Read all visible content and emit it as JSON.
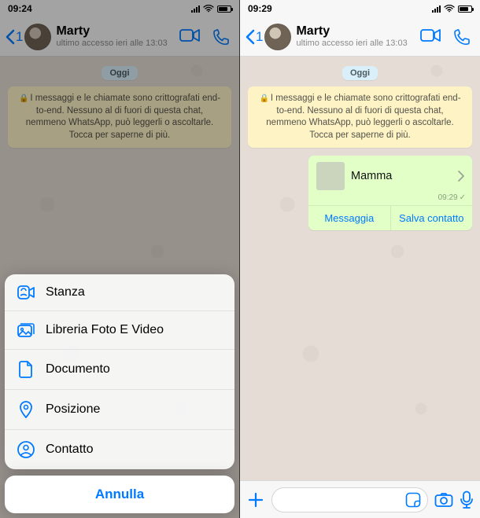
{
  "left": {
    "status_time": "09:24",
    "back_count": "1",
    "contact_name": "Marty",
    "last_seen": "ultimo accesso ieri alle 13:03",
    "day_label": "Oggi",
    "encryption_text": "I messaggi e le chiamate sono crittografati end-to-end. Nessuno al di fuori di questa chat, nemmeno WhatsApp, può leggerli o ascoltarle. Tocca per saperne di più.",
    "sheet": {
      "items": [
        {
          "label": "Stanza"
        },
        {
          "label": "Libreria Foto E Video"
        },
        {
          "label": "Documento"
        },
        {
          "label": "Posizione"
        },
        {
          "label": "Contatto"
        }
      ],
      "cancel": "Annulla"
    }
  },
  "right": {
    "status_time": "09:29",
    "back_count": "1",
    "contact_name": "Marty",
    "last_seen": "ultimo accesso ieri alle 13:03",
    "day_label": "Oggi",
    "encryption_text": "I messaggi e le chiamate sono crittografati end-to-end. Nessuno al di fuori di questa chat, nemmeno WhatsApp, può leggerli o ascoltarle. Tocca per saperne di più.",
    "contact_card": {
      "name": "Mamma",
      "time": "09:29",
      "action_message": "Messaggia",
      "action_save": "Salva contatto"
    }
  },
  "colors": {
    "ios_blue": "#007aff",
    "bubble_green": "#e2ffc7",
    "banner_yellow": "#fdf3c5"
  }
}
